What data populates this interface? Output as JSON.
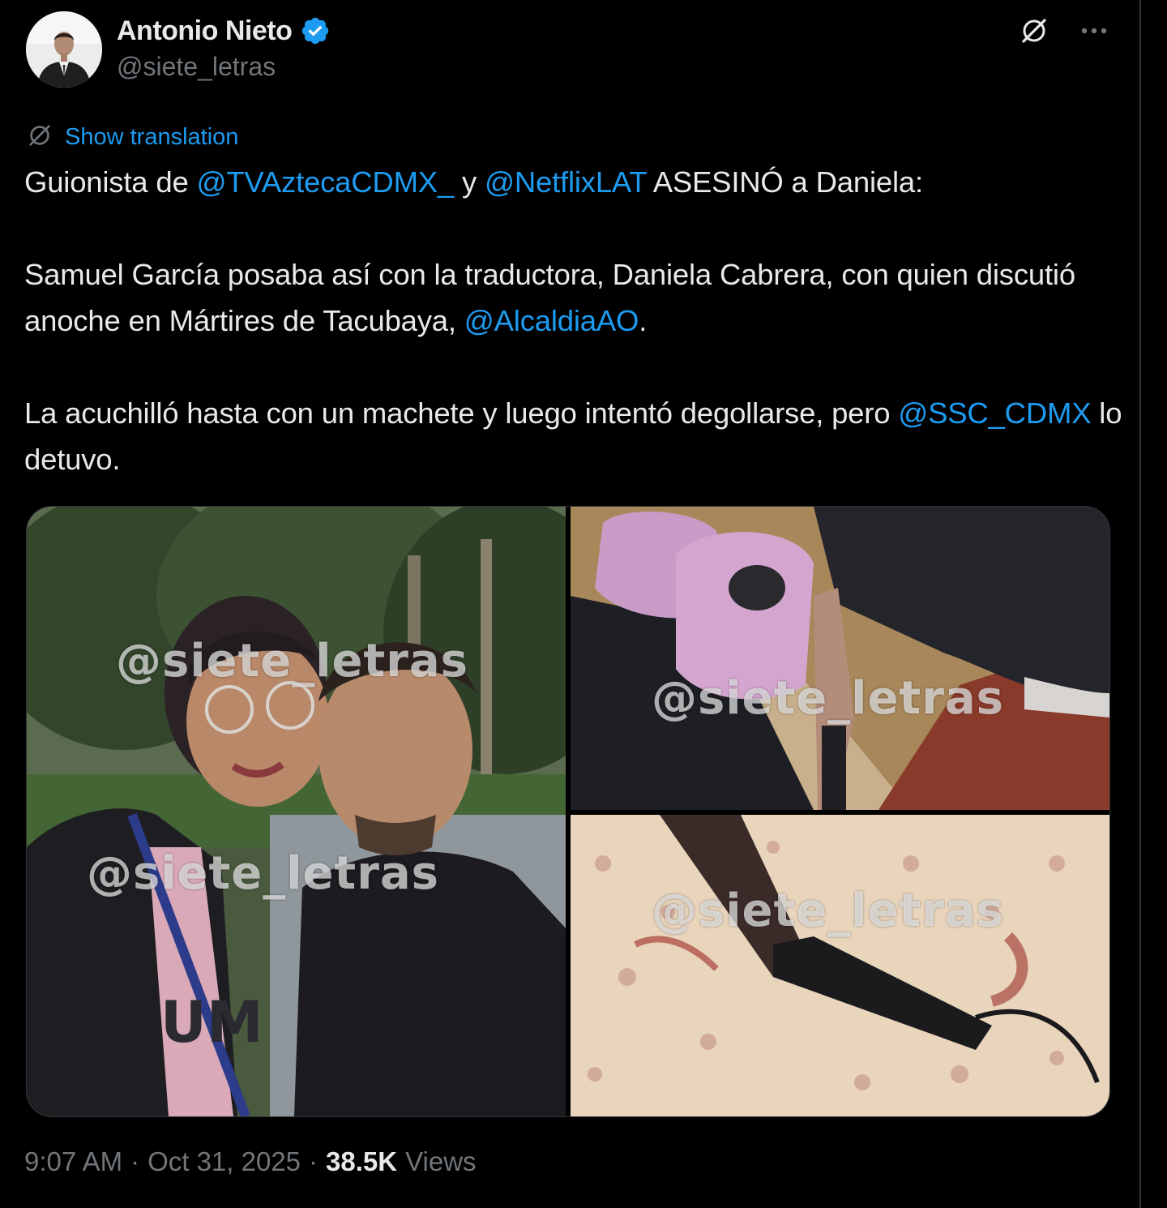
{
  "author": {
    "name": "Antonio Nieto",
    "handle": "@siete_letras",
    "verified": true
  },
  "icons": {
    "verified": "verified-badge-icon",
    "grok": "grok-icon",
    "more": "more-icon",
    "translate": "translate-icon"
  },
  "colors": {
    "background": "#000000",
    "text": "#e7e9ea",
    "muted": "#71767b",
    "link": "#1d9bf0"
  },
  "translation": {
    "label": "Show translation"
  },
  "tweet": {
    "p1": {
      "t1": "Guionista de ",
      "m1": "@TVAztecaCDMX_",
      "t2": " y ",
      "m2": "@NetflixLAT",
      "t3": " ASESINÓ a Daniela:"
    },
    "p2": {
      "t1": "Samuel García posaba así con la traductora, Daniela Cabrera, con quien discutió anoche en Mártires de Tacubaya, ",
      "m1": "@AlcaldiaAO",
      "t2": "."
    },
    "p3": {
      "t1": "La acuchilló hasta con un machete y luego intentó degollarse, pero ",
      "m1": "@SSC_CDMX",
      "t2": " lo detuvo."
    }
  },
  "media": {
    "watermarks": [
      "@siete_letras",
      "@siete_letras",
      "@siete_letras",
      "@siete_letras"
    ]
  },
  "meta": {
    "time": "9:07 AM",
    "sep1": "·",
    "date": "Oct 31, 2025",
    "sep2": "·",
    "views_count": "38.5K",
    "views_label": "Views"
  }
}
